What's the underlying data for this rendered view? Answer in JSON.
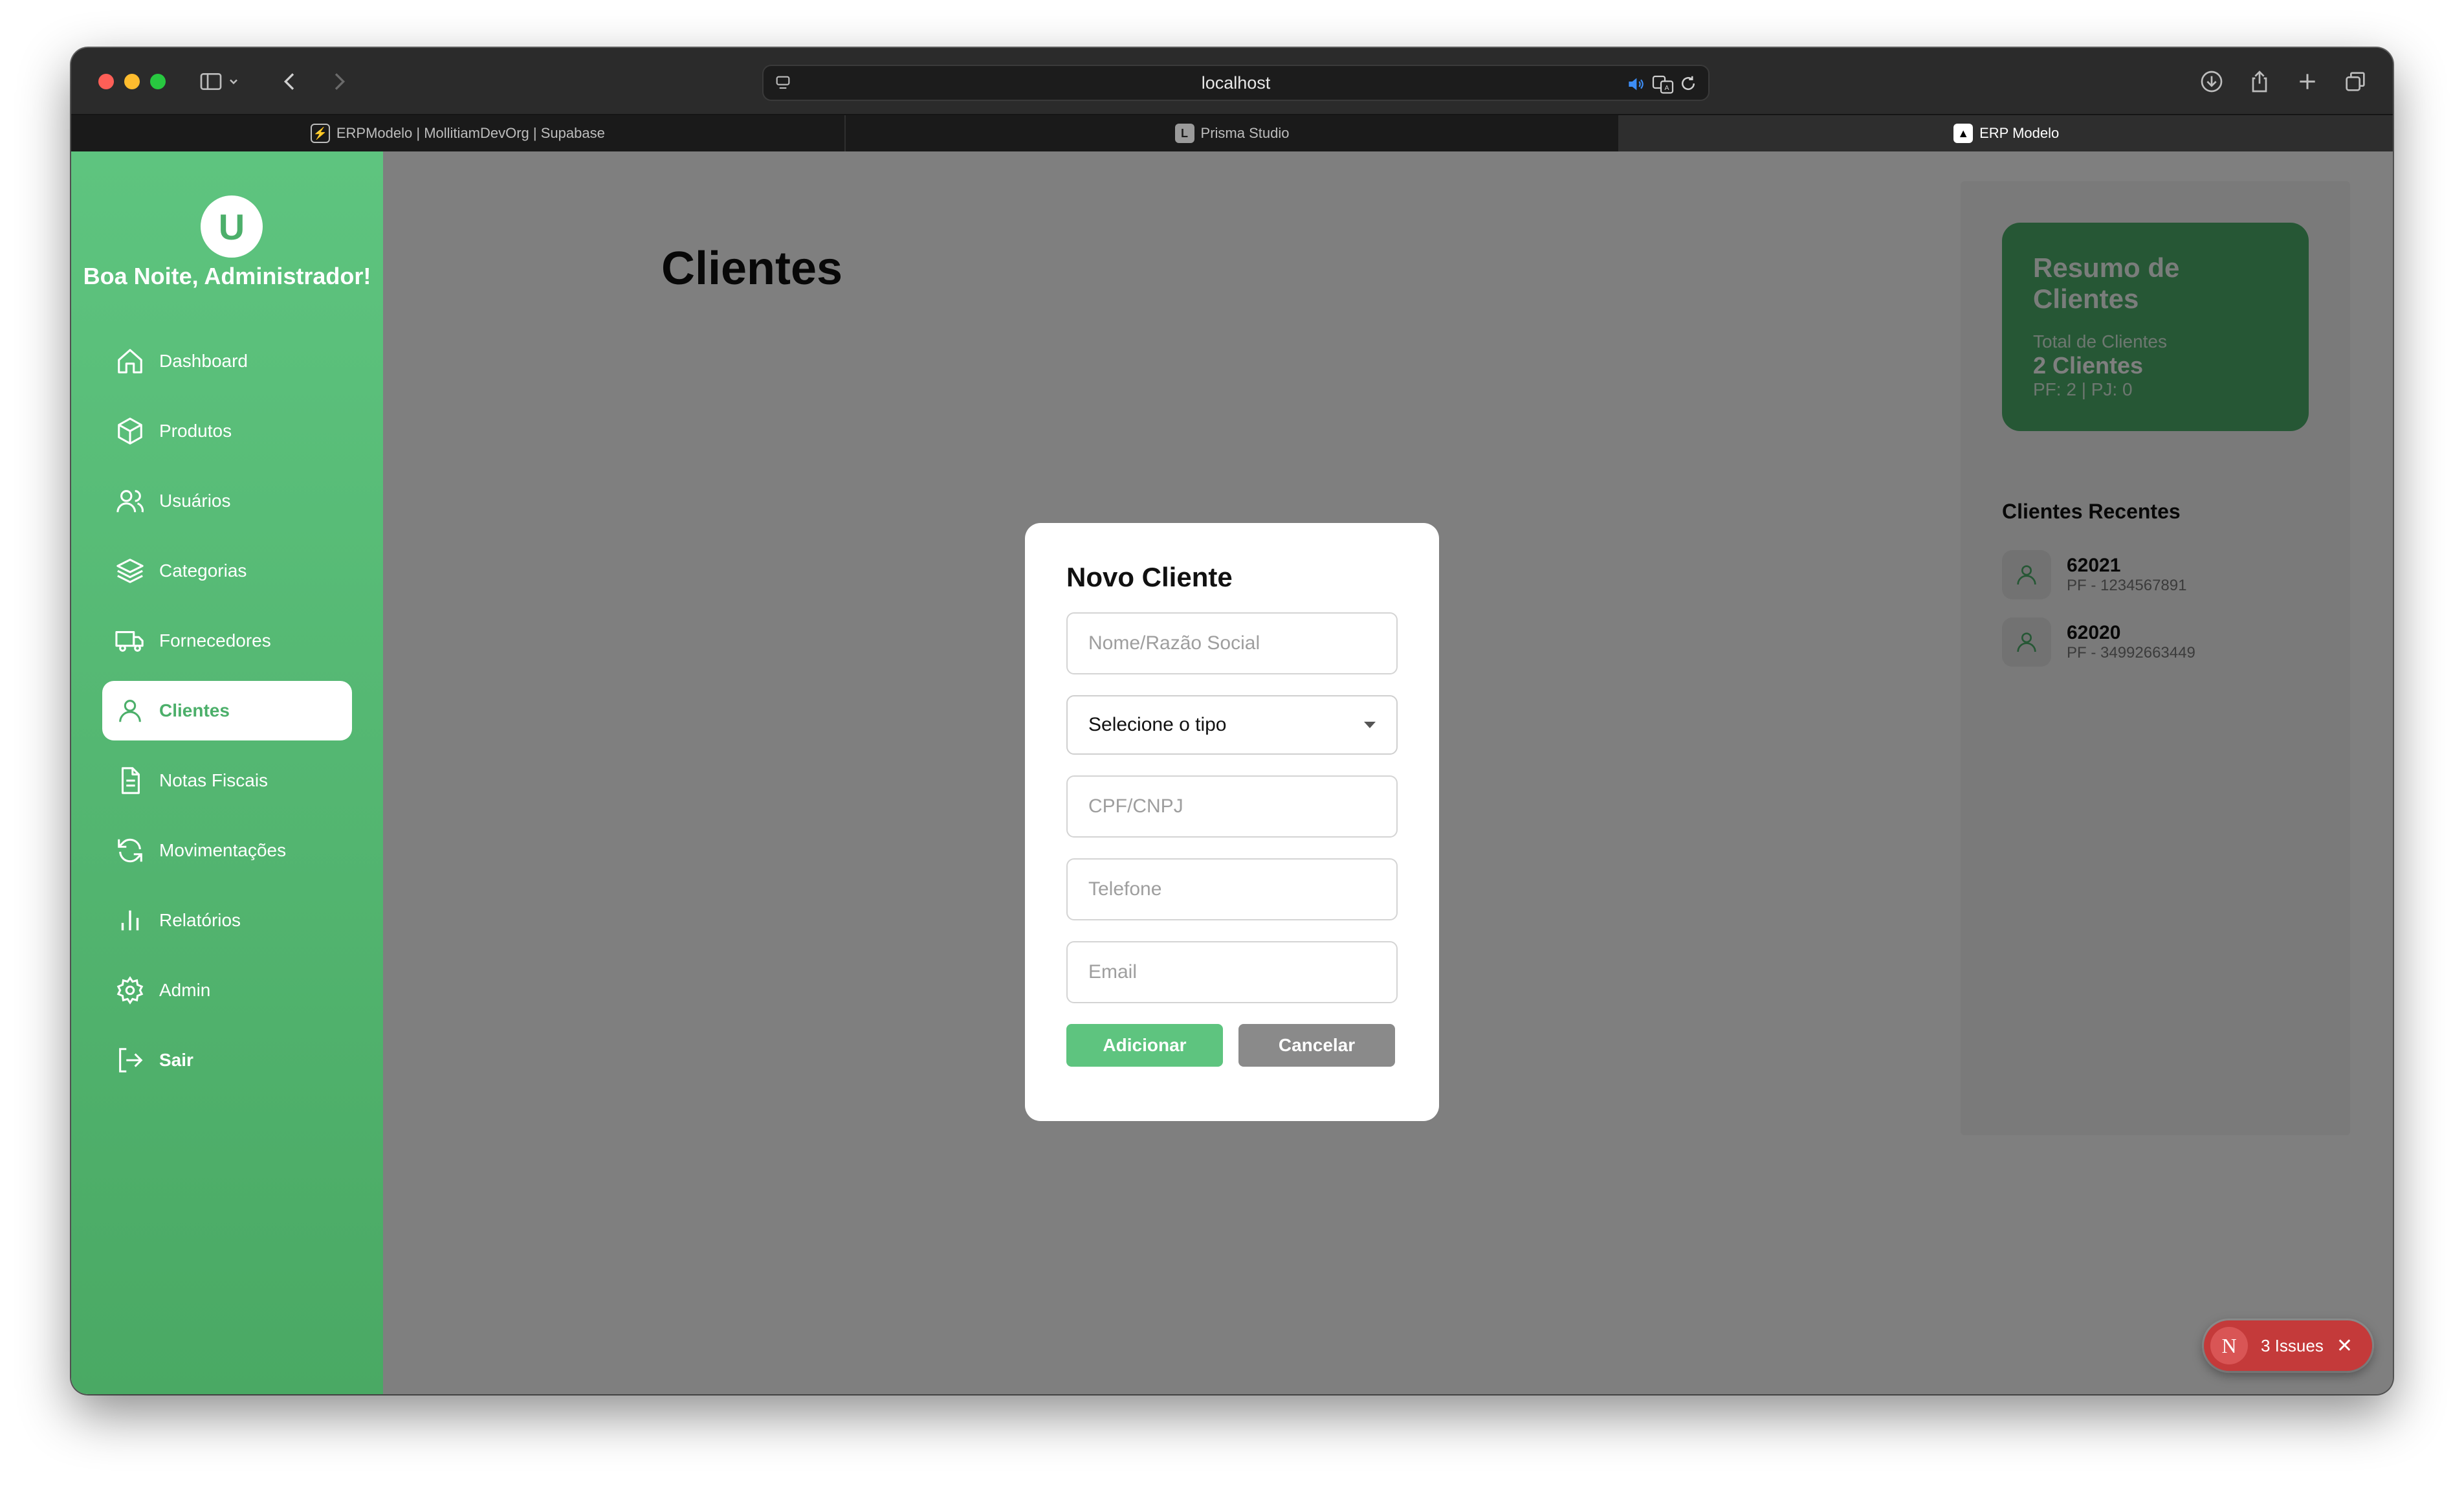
{
  "browser": {
    "url": "localhost",
    "tabs": [
      {
        "label": "ERPModelo | MollitiamDevOrg | Supabase",
        "icon": "supabase-icon"
      },
      {
        "label": "Prisma Studio",
        "icon": "prisma-icon"
      },
      {
        "label": "ERP Modelo",
        "icon": "erp-icon"
      }
    ]
  },
  "sidebar": {
    "avatar_letter": "U",
    "greeting": "Boa Noite, Administrador!",
    "items": [
      {
        "label": "Dashboard",
        "icon": "home-icon"
      },
      {
        "label": "Produtos",
        "icon": "box-icon"
      },
      {
        "label": "Usuários",
        "icon": "users-icon"
      },
      {
        "label": "Categorias",
        "icon": "layers-icon"
      },
      {
        "label": "Fornecedores",
        "icon": "truck-icon"
      },
      {
        "label": "Clientes",
        "icon": "user-icon",
        "active": true
      },
      {
        "label": "Notas Fiscais",
        "icon": "document-icon"
      },
      {
        "label": "Movimentações",
        "icon": "refresh-icon"
      },
      {
        "label": "Relatórios",
        "icon": "bar-chart-icon"
      },
      {
        "label": "Admin",
        "icon": "gear-icon"
      },
      {
        "label": "Sair",
        "icon": "logout-icon"
      }
    ]
  },
  "main": {
    "title": "Clientes"
  },
  "summary": {
    "title": "Resumo de Clientes",
    "total_label": "Total de Clientes",
    "total_value": "2 Clientes",
    "breakdown": "PF: 2 | PJ: 0"
  },
  "recent": {
    "title": "Clientes Recentes",
    "items": [
      {
        "name": "62021",
        "sub": "PF - 1234567891"
      },
      {
        "name": "62020",
        "sub": "PF - 34992663449"
      }
    ]
  },
  "modal": {
    "title": "Novo Cliente",
    "name_placeholder": "Nome/Razão Social",
    "type_select": "Selecione o tipo",
    "doc_placeholder": "CPF/CNPJ",
    "phone_placeholder": "Telefone",
    "email_placeholder": "Email",
    "add_label": "Adicionar",
    "cancel_label": "Cancelar"
  },
  "issues": {
    "logo": "N",
    "label": "3 Issues"
  },
  "colors": {
    "brand_green": "#4caf6a",
    "sidebar_green": "#5ec47f",
    "cancel_gray": "#8a8a8a",
    "issues_red": "#c43a3a"
  }
}
